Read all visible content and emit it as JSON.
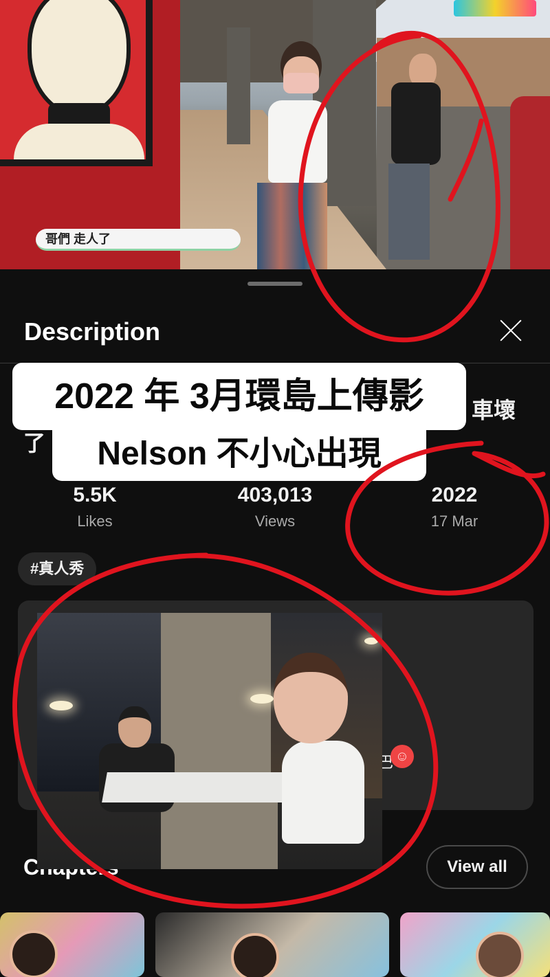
{
  "video": {
    "caption": "哥們 走人了"
  },
  "sheet": {
    "title": "Description",
    "title_fragment_right": "車壞",
    "title_fragment_left": "了"
  },
  "overlay": {
    "line1": "2022 年 3月環島上傳影",
    "line2": "Nelson 不小心出現"
  },
  "stats": [
    {
      "value": "5.5K",
      "label": "Likes"
    },
    {
      "value": "403,013",
      "label": "Views"
    },
    {
      "value": "2022",
      "label": "17 Mar"
    }
  ],
  "hashtag": "#真人秀",
  "description_fragment": "巴",
  "chapters": {
    "title": "Chapters",
    "view_all": "View all"
  },
  "colors": {
    "background": "#0f0f0f",
    "card": "#272727",
    "annotation": "#e0141e"
  },
  "icons": [
    "close-icon",
    "emoji-face-icon"
  ]
}
